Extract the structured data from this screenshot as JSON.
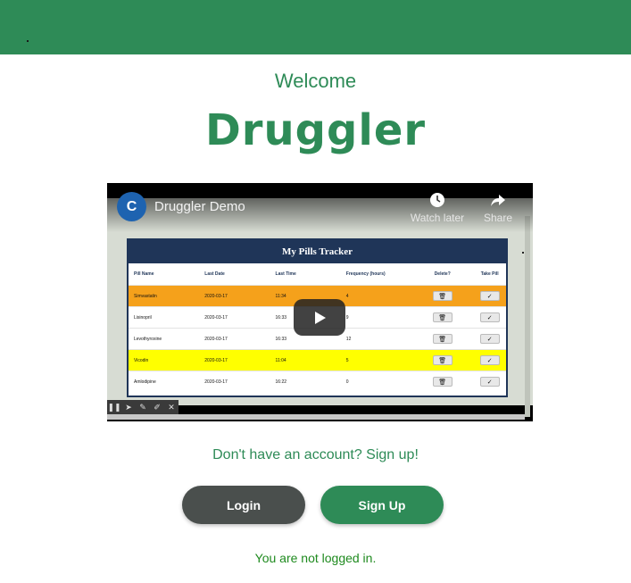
{
  "header": {
    "bg_color": "#2e8b57"
  },
  "welcome_text": "Welcome",
  "app_name": "Druggler",
  "video": {
    "channel_initial": "C",
    "title": "Druggler Demo",
    "watch_later_label": "Watch later",
    "share_label": "Share",
    "tracker": {
      "title": "My Pills Tracker",
      "columns": [
        "Pill Name",
        "Last Date",
        "Last Time",
        "Frequency (hours)",
        "Delete?",
        "Take Pill"
      ],
      "rows": [
        {
          "name": "Simvastatin",
          "date": "2020-03-17",
          "time": "11:34",
          "freq": "4",
          "highlight": "orange"
        },
        {
          "name": "Lisinopril",
          "date": "2020-03-17",
          "time": "16:33",
          "freq": "9",
          "highlight": ""
        },
        {
          "name": "Levothyroxine",
          "date": "2020-03-17",
          "time": "16:33",
          "freq": "12",
          "highlight": ""
        },
        {
          "name": "Vicodin",
          "date": "2020-03-17",
          "time": "11:04",
          "freq": "5",
          "highlight": "yellow"
        },
        {
          "name": "Amlodipine",
          "date": "2020-03-17",
          "time": "16:22",
          "freq": "0",
          "highlight": ""
        }
      ]
    }
  },
  "signup_prompt": "Don't have an account? Sign up!",
  "buttons": {
    "login_label": "Login",
    "signup_label": "Sign Up"
  },
  "status_text": "You are not logged in.",
  "colors": {
    "primary": "#2e8b57",
    "login_button": "#4a4f4d",
    "status": "#1e8a1e"
  }
}
